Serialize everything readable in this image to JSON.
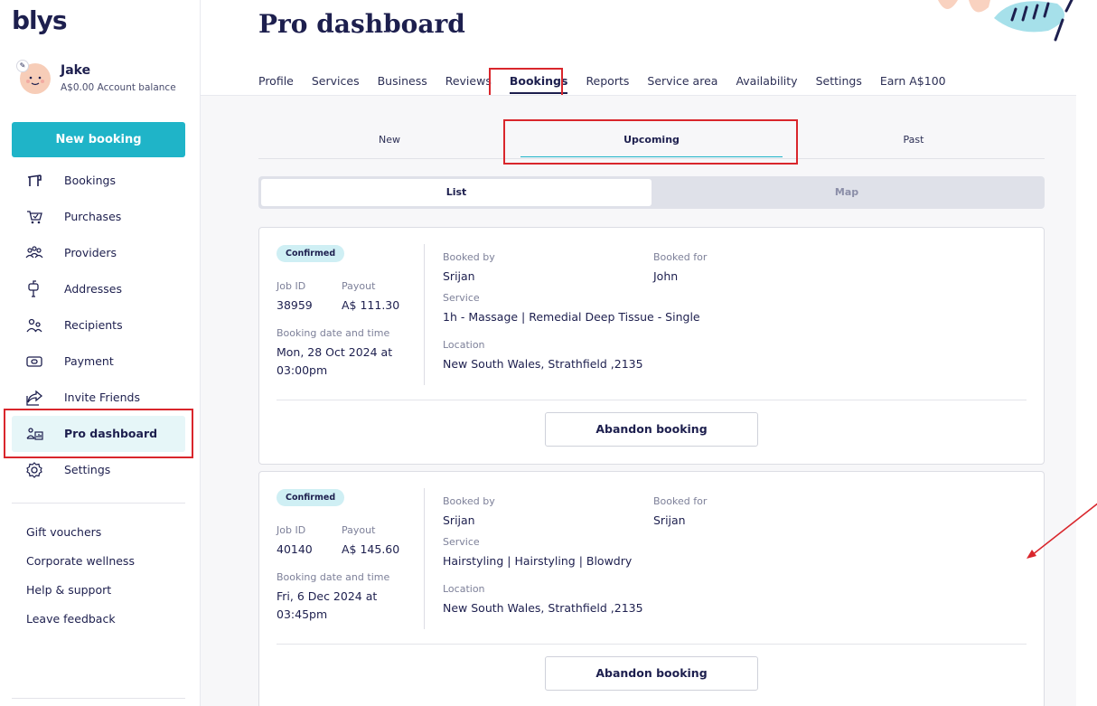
{
  "app": {
    "logo": "blys"
  },
  "user": {
    "name": "Jake",
    "balance": "A$0.00 Account balance"
  },
  "sidebar": {
    "new_booking": "New booking",
    "items": [
      {
        "label": "Bookings",
        "icon": "bookings-icon"
      },
      {
        "label": "Purchases",
        "icon": "cart-icon"
      },
      {
        "label": "Providers",
        "icon": "providers-icon"
      },
      {
        "label": "Addresses",
        "icon": "mailbox-icon"
      },
      {
        "label": "Recipients",
        "icon": "recipients-icon"
      },
      {
        "label": "Payment",
        "icon": "payment-icon"
      },
      {
        "label": "Invite Friends",
        "icon": "share-icon"
      },
      {
        "label": "Pro dashboard",
        "icon": "pro-dashboard-icon"
      },
      {
        "label": "Settings",
        "icon": "gear-icon"
      }
    ],
    "footer_links": [
      "Gift vouchers",
      "Corporate wellness",
      "Help & support",
      "Leave feedback"
    ]
  },
  "page": {
    "title": "Pro dashboard",
    "tabs": [
      "Profile",
      "Services",
      "Business",
      "Reviews",
      "Bookings",
      "Reports",
      "Service area",
      "Availability",
      "Settings",
      "Earn A$100"
    ],
    "active_tab": "Bookings",
    "subtabs": [
      "New",
      "Upcoming",
      "Past"
    ],
    "active_subtab": "Upcoming",
    "view_toggle": [
      "List",
      "Map"
    ],
    "active_view": "List"
  },
  "labels": {
    "job_id": "Job ID",
    "payout": "Payout",
    "booking_datetime": "Booking date and time",
    "booked_by": "Booked by",
    "booked_for": "Booked for",
    "service": "Service",
    "location": "Location",
    "abandon": "Abandon booking"
  },
  "bookings": [
    {
      "status": "Confirmed",
      "job_id": "38959",
      "payout": "A$ 111.30",
      "datetime": "Mon, 28 Oct 2024 at 03:00pm",
      "booked_by": "Srijan",
      "booked_for": "John",
      "service": "1h - Massage | Remedial Deep Tissue - Single",
      "location": "New South Wales, Strathfield ,2135"
    },
    {
      "status": "Confirmed",
      "job_id": "40140",
      "payout": "A$ 145.60",
      "datetime": "Fri, 6 Dec 2024 at 03:45pm",
      "booked_by": "Srijan",
      "booked_for": "Srijan",
      "service": "Hairstyling | Hairstyling | Blowdry",
      "location": "New South Wales, Strathfield ,2135"
    }
  ],
  "colors": {
    "accent": "#1fb4c8",
    "navy": "#1d1f4e",
    "annotation": "#d9262c"
  }
}
